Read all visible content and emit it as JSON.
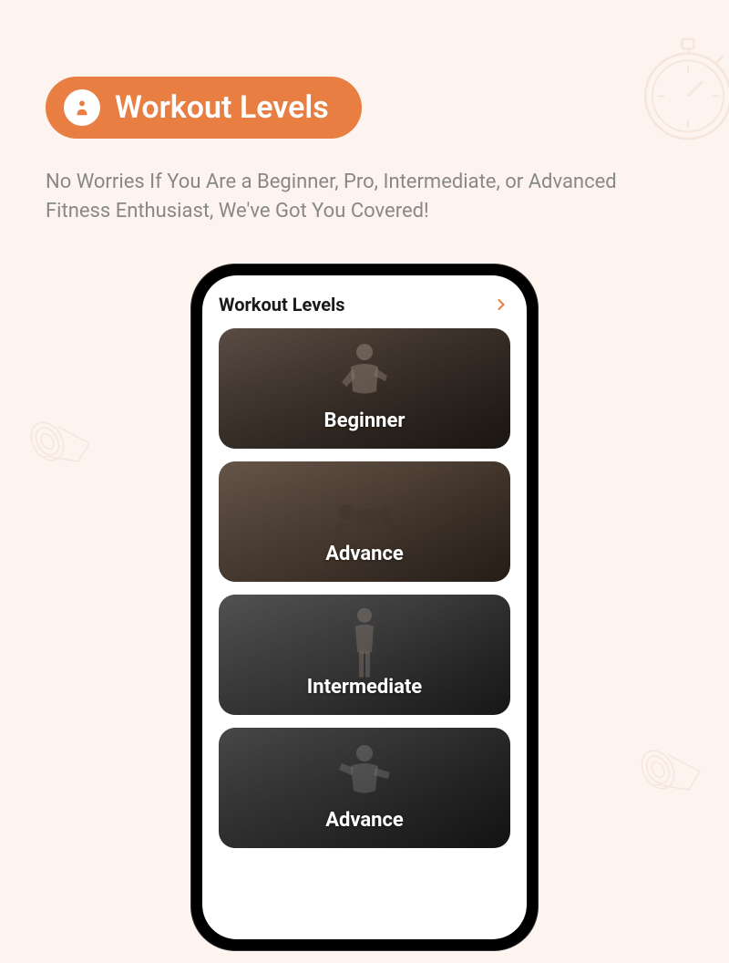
{
  "header": {
    "title": "Workout Levels"
  },
  "subtitle": "No Worries If You Are a Beginner, Pro, Intermediate, or Advanced Fitness Enthusiast, We've Got You Covered!",
  "phone": {
    "header_title": "Workout Levels",
    "levels": [
      {
        "label": "Beginner"
      },
      {
        "label": "Advance"
      },
      {
        "label": "Intermediate"
      },
      {
        "label": "Advance"
      }
    ]
  }
}
